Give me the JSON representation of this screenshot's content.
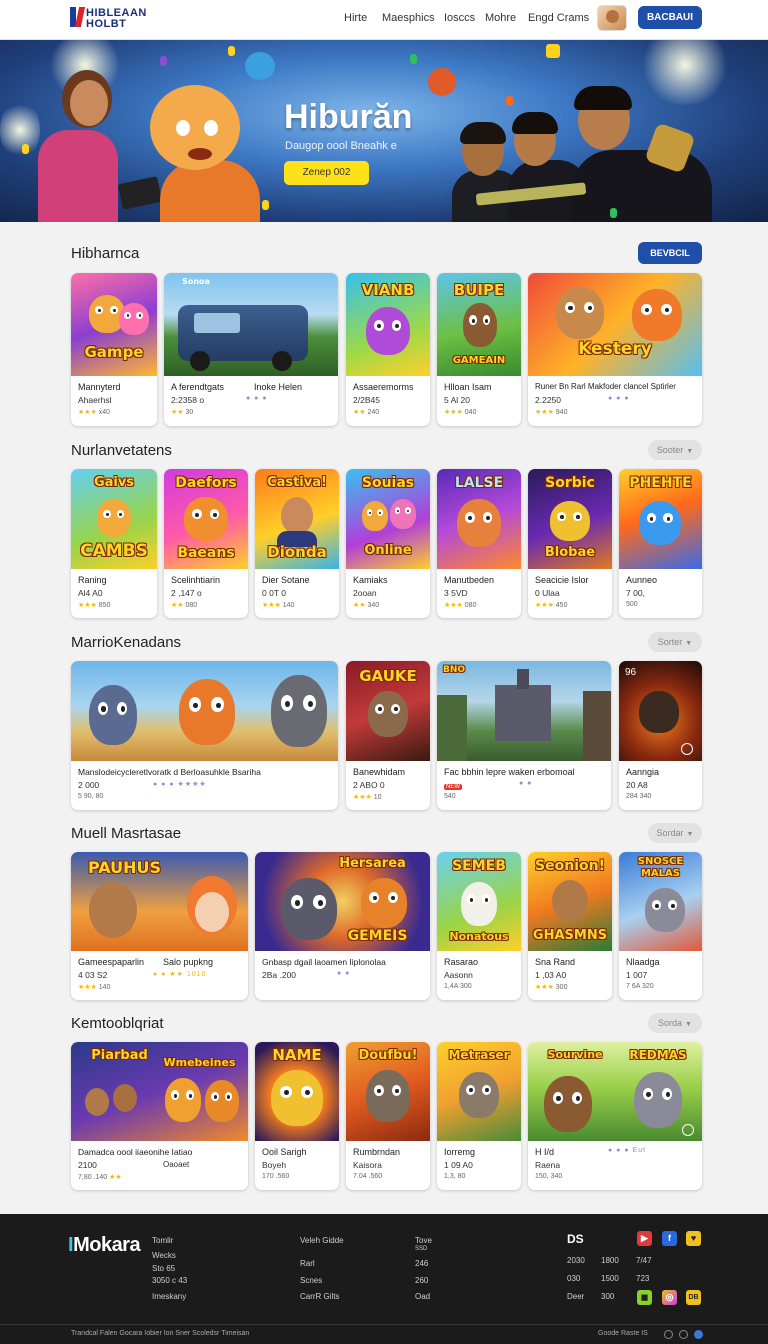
{
  "header": {
    "logo_line1": "HIBLEAAN",
    "logo_line2": "HOLBT",
    "nav": [
      "Hirte",
      "Maesphics",
      "Iosccs",
      "Mohre",
      "Engd Crams"
    ],
    "action_button": "BACBAUI"
  },
  "hero": {
    "title": "Hiburăn",
    "subtitle": "Daugop oool Bneahk e",
    "button": "Zenep 002"
  },
  "sections": [
    {
      "title": "Hibharnca",
      "button": "BEVBCIL",
      "cards": [
        {
          "art": "Gampe",
          "t1": "Mannyterd",
          "t2": "Ahaerhsl",
          "rating": "★★★",
          "t3": "ẋ40"
        },
        {
          "art": "Sonoa",
          "t1": "A ferendtgats",
          "t2": "2:2358 o",
          "rating": "★★",
          "t3": "30",
          "extra1": "Inoke Helen",
          "extra2": "● ● ●"
        },
        {
          "art": "VIANB",
          "t1": "Assaeremorms",
          "t2": "2/2B45",
          "rating": "★★",
          "t3": "240"
        },
        {
          "art": "BUIPE",
          "art2": "GAMEAIN",
          "t1": "Hlloan Isam",
          "t2": "5 Al 20",
          "rating": "★★★",
          "t3": "040"
        },
        {
          "art": "Kestery",
          "t1": "Runer Bn Rarl Makfoder clancel Sptirler",
          "t2": "2.2250",
          "rating": "★★★",
          "t3": "940",
          "extra2": "● ● ●"
        }
      ]
    },
    {
      "title": "Nurlanvetatens",
      "button": "Sooter",
      "cards": [
        {
          "art": "Gaivs",
          "art2": "CAMBS",
          "t1": "Raning",
          "t2": "Al4 A0",
          "rating": "★★★",
          "t3": "850"
        },
        {
          "art": "Daefors",
          "art2": "Baeans",
          "t1": "Scelinhtiarin",
          "t2": "2 ,147 o",
          "rating": "★★",
          "t3": "080"
        },
        {
          "art": "Castiva!",
          "art2": "Dionda",
          "t1": "Dier Sotane",
          "t2": "0 0T 0",
          "rating": "★★★",
          "t3": "140"
        },
        {
          "art": "Souias",
          "art2": "Online",
          "t1": "Kamiaks",
          "t2": "2ooan",
          "rating": "★★",
          "t3": "340"
        },
        {
          "art": "LALSE",
          "t1": "Manutbeden",
          "t2": "3 5VD",
          "rating": "★★★",
          "t3": "080"
        },
        {
          "art": "Sorbic",
          "art2": "Blobae",
          "t1": "Seacicie Islor",
          "t2": "0 Ulaa",
          "rating": "★★★",
          "t3": "450"
        },
        {
          "art": "PHEHTE",
          "t1": "Aunneo",
          "t2": "7 00, ",
          "rating": "",
          "t3": "500"
        }
      ]
    },
    {
      "title": "MarrioKenadans",
      "button": "Sorter",
      "cards": [
        {
          "art": "",
          "t1": "Manslodeicycleretlvoratk d Berloasuhkle Bsariha",
          "t2": "2 000",
          "rating": "",
          "t3": "5 90, 80",
          "extra2": "● ●   ● ★★★★"
        },
        {
          "art": "GAUKE",
          "t1": "Banewhidam",
          "t2": "2 ABO 0",
          "rating": "★★★",
          "t3": "10"
        },
        {
          "art": "BNO",
          "t1": "Fac bbhin lepre waken erbomoal",
          "t2": "NEW",
          "rating": "",
          "t3": "540",
          "extra2": "● ●"
        },
        {
          "art": "96",
          "t1": "Aanngia",
          "t2": "20 A8",
          "rating": "",
          "t3": "284 340"
        }
      ]
    },
    {
      "title": "Muell Masrtasae",
      "button": "Sordar",
      "cards": [
        {
          "art": "PAUHUS",
          "t1": "Gameespaparlin",
          "t2": "4 03 S2",
          "rating": "★★★",
          "t3": "140",
          "extra1": "Salo pupkng",
          "extra3": "● ●   ★★ 1010"
        },
        {
          "art": "Hersarea",
          "art2": "GEMEIS",
          "t1": "Gnbasp dgail laoamen Iiplonolaa",
          "t2": "2Ba .200",
          "rating": "",
          "t3": "",
          "extra2": "● ●"
        },
        {
          "art": "SEMEB",
          "art2": "Nonatous",
          "t1": "Rasarao",
          "t2": "Aasonn",
          "rating": "",
          "t3": "1,4A 300"
        },
        {
          "art": "Seonion!",
          "art2": "GHASMNS",
          "t1": "Sna Rand",
          "t2": "1 ,03 A0",
          "rating": "★★★",
          "t3": "300"
        },
        {
          "art": "SNOSCE",
          "art2": "MALAS",
          "t1": "Nlaadga",
          "t2": "1 007",
          "rating": "",
          "t3": "7 6A 320"
        }
      ]
    },
    {
      "title": "Kemtooblqriat",
      "button": "Sorda",
      "cards": [
        {
          "art": "Piarbad",
          "art2": "Wmebeines",
          "t1": "Damadca oool iiaeonihe Iatiao",
          "t2": "2100 ",
          "rating": "★★",
          "t3": "7,80 .140",
          "extra1": "Oaoaet"
        },
        {
          "art": "NAME",
          "t1": "Ooil Sarigh",
          "t2": "Boyeh",
          "rating": "",
          "t3": "170 .560"
        },
        {
          "art": "Doufbu!",
          "t1": "Rumbrndan",
          "t2": "Kaisora",
          "rating": "",
          "t3": "7.04 .560"
        },
        {
          "art": "Metraser",
          "t1": "Iorremg",
          "t2": "1 09 A0",
          "rating": "",
          "t3": "1,3, 80"
        },
        {
          "art": "Sourvine",
          "art2": "REDMAS",
          "t1": "H I/d",
          "t2": "Raena",
          "rating": "",
          "t3": "150, 340",
          "extra1": "● ● ● Eut"
        }
      ]
    }
  ],
  "footer": {
    "logo_main": "Mokara",
    "logo_accent": "I",
    "col1": [
      "Tomlir",
      "Wecks",
      "Sto 65",
      "3050 c 43",
      "Imeskany"
    ],
    "col2": [
      "Veleh Gidde",
      "Rarl",
      "Scnes",
      "CarrR Gilts"
    ],
    "col3": [
      "Tove",
      "SSD",
      "246",
      "260",
      "Oad"
    ],
    "col4_title": "DS",
    "col4": [
      [
        "2030",
        "1800",
        "7/47"
      ],
      [
        "030",
        "1500",
        "723"
      ],
      [
        "Deer",
        "300",
        ""
      ]
    ],
    "bottom_links": "Trandcal  Falen  Gocara  Iobier  Ion Sner  Scoledsr  Timeisan",
    "bottom_right": "Goode Raste  IS"
  },
  "colors": {
    "accent_blue": "#1f4fa8",
    "hero_button": "#ffe11a",
    "footer_bg": "#1b1b1b",
    "star": "#f2b90c"
  }
}
